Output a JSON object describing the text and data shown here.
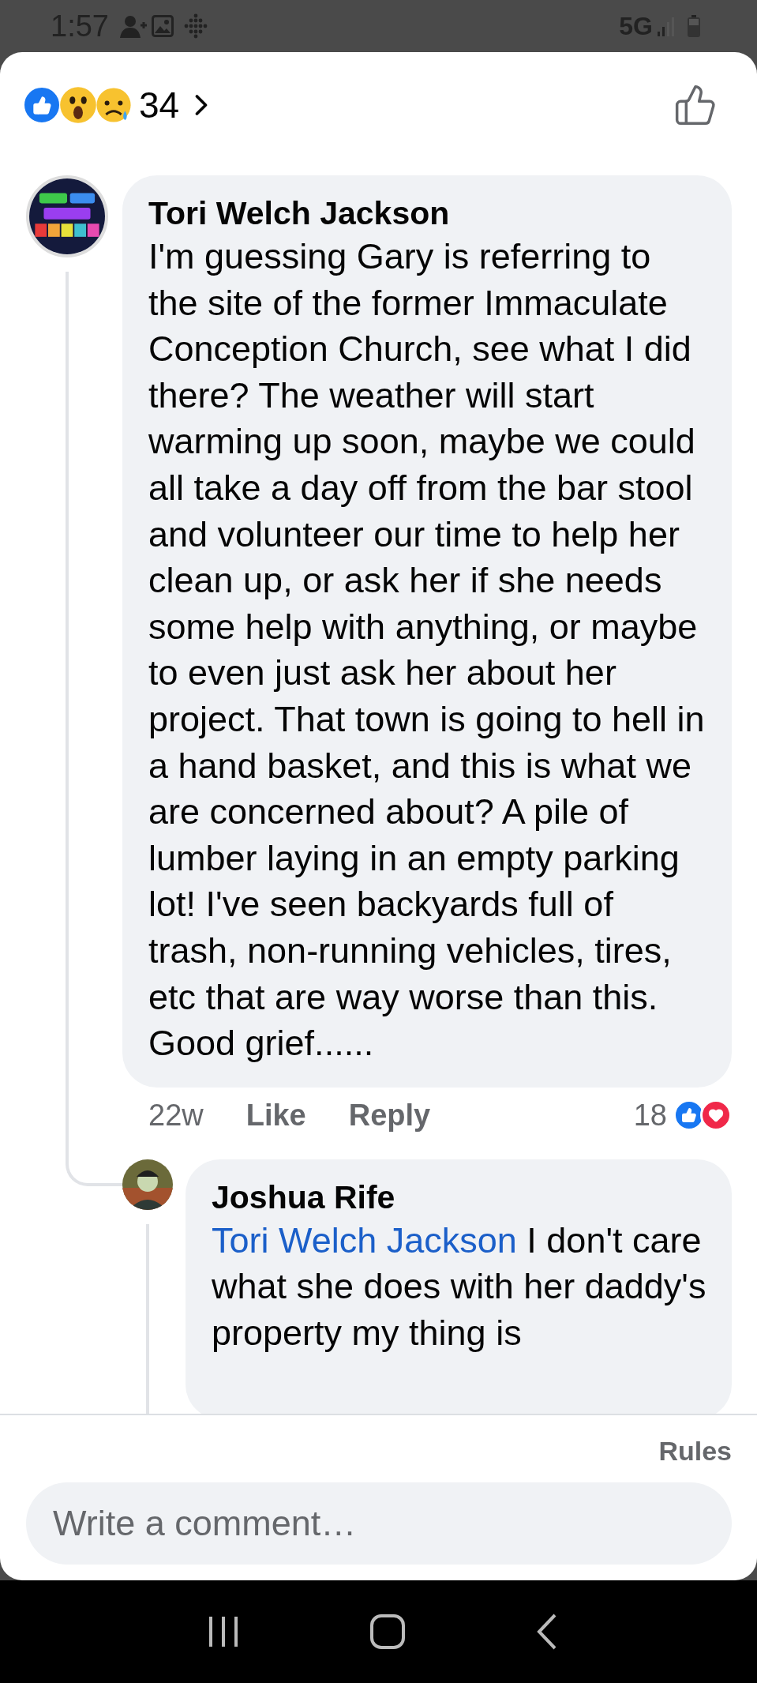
{
  "status_bar": {
    "time": "1:57",
    "network": "5G"
  },
  "reactions": {
    "count": "34"
  },
  "comments": [
    {
      "author": "Tori Welch Jackson",
      "text": "I'm guessing Gary is referring to the site of the former Immaculate Conception Church, see what I did there? The weather will start warming up soon, maybe we could all take a day off from the bar stool and volunteer our time to help her clean up, or ask her if she needs some help with anything, or maybe to even just ask her about her project. That town is going to hell in a hand basket, and this is what we are concerned about? A pile of lumber laying in an empty parking lot! I've seen backyards full of trash, non-running vehicles, tires, etc that are way worse than this. Good grief......",
      "time": "22w",
      "actions": [
        "Like",
        "Reply"
      ],
      "reaction_count": "18",
      "replies": [
        {
          "author": "Joshua Rife",
          "mention": "Tori Welch Jackson",
          "text": "I don't care what she does with her daddy's property my thing is"
        }
      ]
    }
  ],
  "rules_link": "Rules",
  "comment_field": {
    "placeholder": "Write a comment…"
  }
}
